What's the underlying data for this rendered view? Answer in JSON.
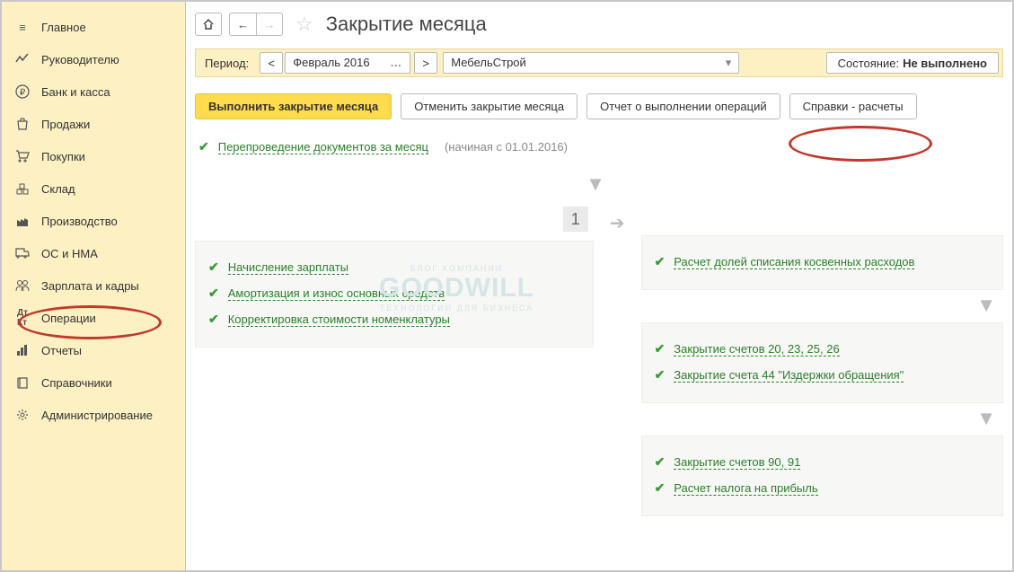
{
  "sidebar": {
    "items": [
      {
        "label": "Главное"
      },
      {
        "label": "Руководителю"
      },
      {
        "label": "Банк и касса"
      },
      {
        "label": "Продажи"
      },
      {
        "label": "Покупки"
      },
      {
        "label": "Склад"
      },
      {
        "label": "Производство"
      },
      {
        "label": "ОС и НМА"
      },
      {
        "label": "Зарплата и кадры"
      },
      {
        "label": "Операции"
      },
      {
        "label": "Отчеты"
      },
      {
        "label": "Справочники"
      },
      {
        "label": "Администрирование"
      }
    ]
  },
  "header": {
    "title": "Закрытие месяца"
  },
  "period": {
    "label": "Период:",
    "value": "Февраль 2016",
    "org": "МебельСтрой",
    "state_label": "Состояние:",
    "state_value": "Не выполнено"
  },
  "actions": {
    "execute": "Выполнить закрытие месяца",
    "cancel": "Отменить закрытие месяца",
    "report": "Отчет о выполнении операций",
    "refs": "Справки - расчеты"
  },
  "repost": {
    "link": "Перепроведение документов за месяц",
    "hint": "(начиная с 01.01.2016)"
  },
  "left_block": {
    "items": [
      "Начисление зарплаты",
      "Амортизация и износ основных средств",
      "Корректировка стоимости номенклатуры"
    ]
  },
  "right_blocks": {
    "step": "1",
    "b1": [
      "Расчет долей списания косвенных расходов"
    ],
    "b2": [
      "Закрытие счетов 20, 23, 25, 26",
      "Закрытие счета 44 \"Издержки обращения\""
    ],
    "b3": [
      "Закрытие счетов 90, 91",
      "Расчет налога на прибыль"
    ]
  },
  "watermark": {
    "t1": "БЛОГ КОМПАНИИ",
    "t2": "GOODWILL",
    "t3": "ТЕХНОЛОГИИ ДЛЯ БИЗНЕСА"
  }
}
